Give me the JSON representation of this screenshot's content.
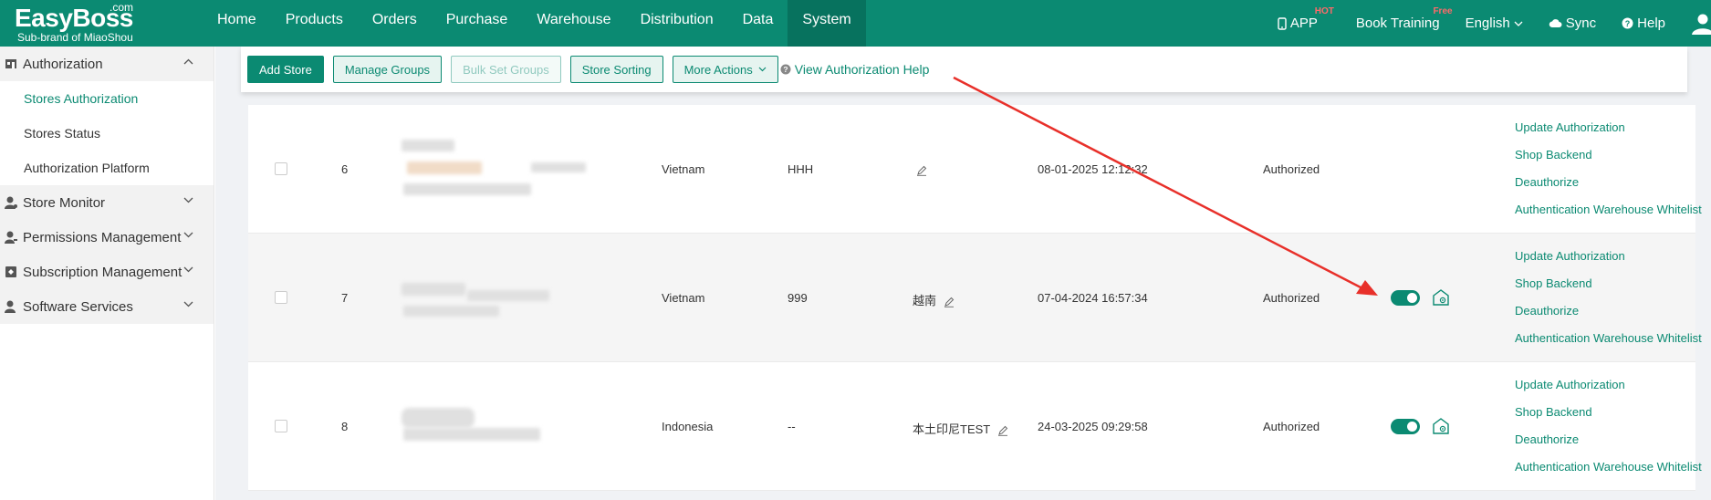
{
  "brand": {
    "name": "EasyBoss",
    "com": ".com",
    "sub": "Sub-brand of MiaoShou"
  },
  "nav": [
    {
      "label": "Home"
    },
    {
      "label": "Products"
    },
    {
      "label": "Orders"
    },
    {
      "label": "Purchase"
    },
    {
      "label": "Warehouse"
    },
    {
      "label": "Distribution"
    },
    {
      "label": "Data"
    },
    {
      "label": "System",
      "active": true
    }
  ],
  "tools": {
    "app": "APP",
    "app_badge": "HOT",
    "training": "Book Training",
    "training_badge": "Free",
    "language": "English",
    "sync": "Sync",
    "help": "Help"
  },
  "sidebar": {
    "groups": [
      {
        "label": "Authorization",
        "open": true,
        "items": [
          {
            "label": "Stores Authorization",
            "active": true
          },
          {
            "label": "Stores Status"
          },
          {
            "label": "Authorization Platform"
          }
        ]
      },
      {
        "label": "Store Monitor"
      },
      {
        "label": "Permissions Management"
      },
      {
        "label": "Subscription Management"
      },
      {
        "label": "Software Services"
      }
    ]
  },
  "toolbar": {
    "add_store": "Add Store",
    "manage_groups": "Manage Groups",
    "bulk_set_groups": "Bulk Set Groups",
    "store_sorting": "Store Sorting",
    "more_actions": "More Actions",
    "help_link": "View Authorization Help"
  },
  "rows": [
    {
      "index": "6",
      "country": "Vietnam",
      "code": "HHH",
      "alias": "",
      "time": "08-01-2025 12:12:32",
      "status": "Authorized",
      "has_toggle": false
    },
    {
      "index": "7",
      "country": "Vietnam",
      "code": "999",
      "alias": "越南",
      "time": "07-04-2024 16:57:34",
      "status": "Authorized",
      "has_toggle": true
    },
    {
      "index": "8",
      "country": "Indonesia",
      "code": "--",
      "alias": "本土印尼TEST",
      "time": "24-03-2025 09:29:58",
      "status": "Authorized",
      "has_toggle": true
    }
  ],
  "row_actions": [
    "Update Authorization",
    "Shop Backend",
    "Deauthorize",
    "Authentication Warehouse Whitelist"
  ],
  "colors": {
    "primary": "#0b8a72",
    "annotation": "#e8302a"
  }
}
